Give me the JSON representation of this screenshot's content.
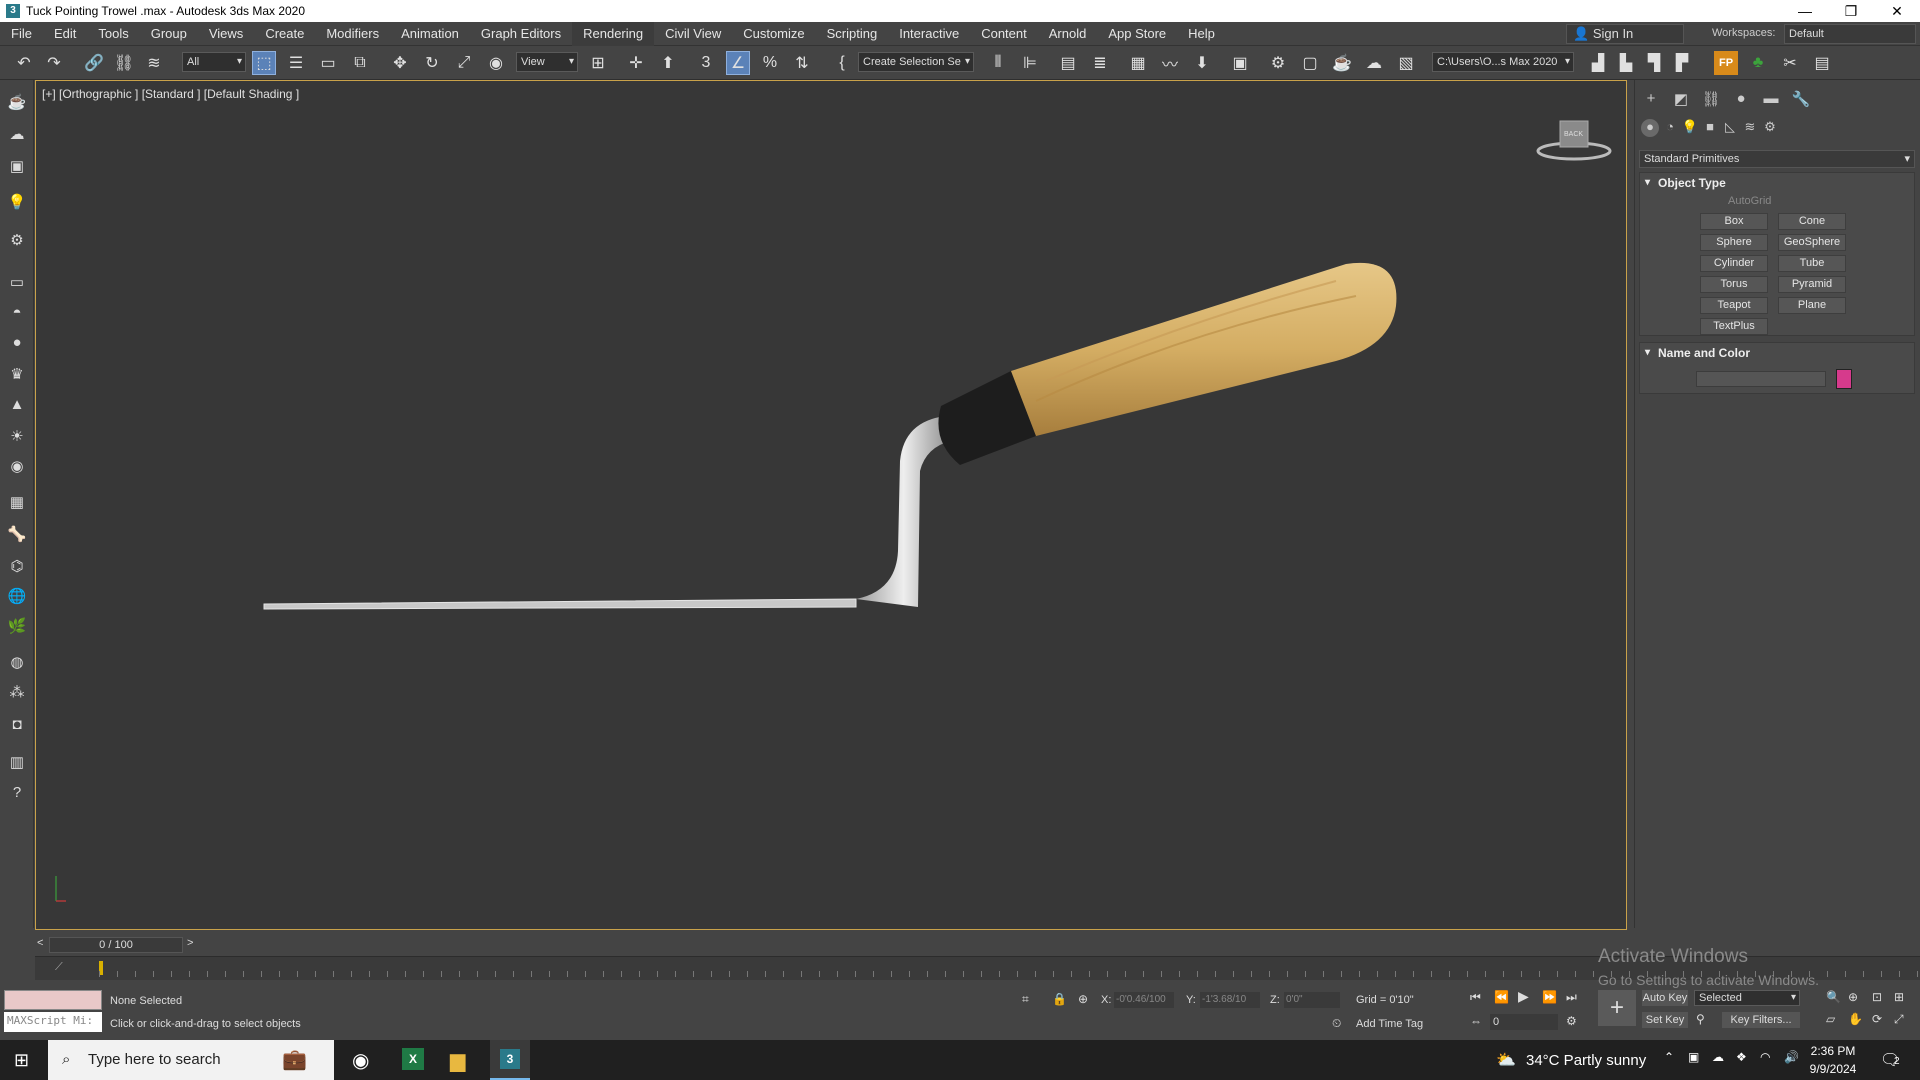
{
  "window": {
    "title": "Tuck Pointing Trowel .max - Autodesk 3ds Max 2020",
    "app_icon": "3",
    "controls": [
      "—",
      "❐",
      "✕"
    ]
  },
  "menu": {
    "items": [
      "File",
      "Edit",
      "Tools",
      "Group",
      "Views",
      "Create",
      "Modifiers",
      "Animation",
      "Graph Editors",
      "Rendering",
      "Civil View",
      "Customize",
      "Scripting",
      "Interactive",
      "Content",
      "Arnold",
      "App Store",
      "Help"
    ],
    "sign_in": "Sign In",
    "workspaces_label": "Workspaces:",
    "workspace_value": "Default"
  },
  "toolbar": {
    "selection_filter": "All",
    "ref_coord": "View",
    "named_selection": "Create Selection Se",
    "project_path": "C:\\Users\\O...s Max 2020"
  },
  "viewport": {
    "label": "[+] [Orthographic ] [Standard ] [Default Shading ]",
    "viewcube_face": "BACK"
  },
  "command_panel": {
    "category_dropdown": "Standard Primitives",
    "object_type": {
      "title": "Object Type",
      "autogrid": "AutoGrid",
      "buttons": [
        "Box",
        "Cone",
        "Sphere",
        "GeoSphere",
        "Cylinder",
        "Tube",
        "Torus",
        "Pyramid",
        "Teapot",
        "Plane",
        "TextPlus"
      ]
    },
    "name_color": {
      "title": "Name and Color",
      "name_value": "",
      "swatch_color": "#d63a8c"
    }
  },
  "timeline": {
    "frame": "0 / 100",
    "prev": "<",
    "next": ">"
  },
  "status": {
    "maxscript": "MAXScript Mi:",
    "selection": "None Selected",
    "prompt": "Click or click-and-drag to select objects",
    "x_label": "X:",
    "x_value": "-0'0.46/100",
    "y_label": "Y:",
    "y_value": "-1'3.68/10",
    "z_label": "Z:",
    "z_value": "0'0\"",
    "grid": "Grid = 0'10\"",
    "add_time_tag": "Add Time Tag",
    "auto_key": "Auto Key",
    "set_key": "Set Key",
    "key_mode": "Selected",
    "key_filters": "Key Filters...",
    "frame_field": "0"
  },
  "watermark": {
    "line1": "Activate Windows",
    "line2": "Go to Settings to activate Windows."
  },
  "taskbar": {
    "search_placeholder": "Type here to search",
    "weather": "34°C  Partly sunny",
    "time": "2:36 PM",
    "date": "9/9/2024",
    "notification_count": "2"
  }
}
